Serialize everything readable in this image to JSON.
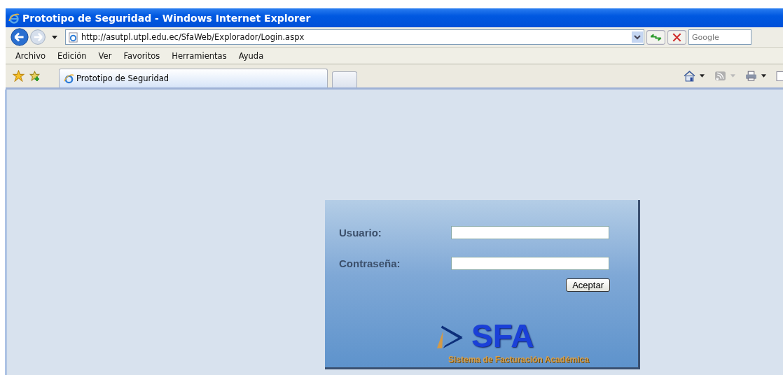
{
  "window": {
    "title": "Prototipo de Seguridad - Windows Internet Explorer"
  },
  "address_bar": {
    "url": "http://asutpl.utpl.edu.ec/SfaWeb/Explorador/Login.aspx"
  },
  "search": {
    "placeholder": "Google"
  },
  "menu": [
    "Archivo",
    "Edición",
    "Ver",
    "Favoritos",
    "Herramientas",
    "Ayuda"
  ],
  "tabs": [
    {
      "label": "Prototipo de Seguridad",
      "selected": true
    }
  ],
  "login": {
    "fields": [
      {
        "label": "Usuario:"
      },
      {
        "label": "Contraseña:"
      }
    ],
    "button": "Aceptar",
    "logo": {
      "name": "SFA",
      "tagline": "Sistema de Facturación Académica"
    }
  }
}
